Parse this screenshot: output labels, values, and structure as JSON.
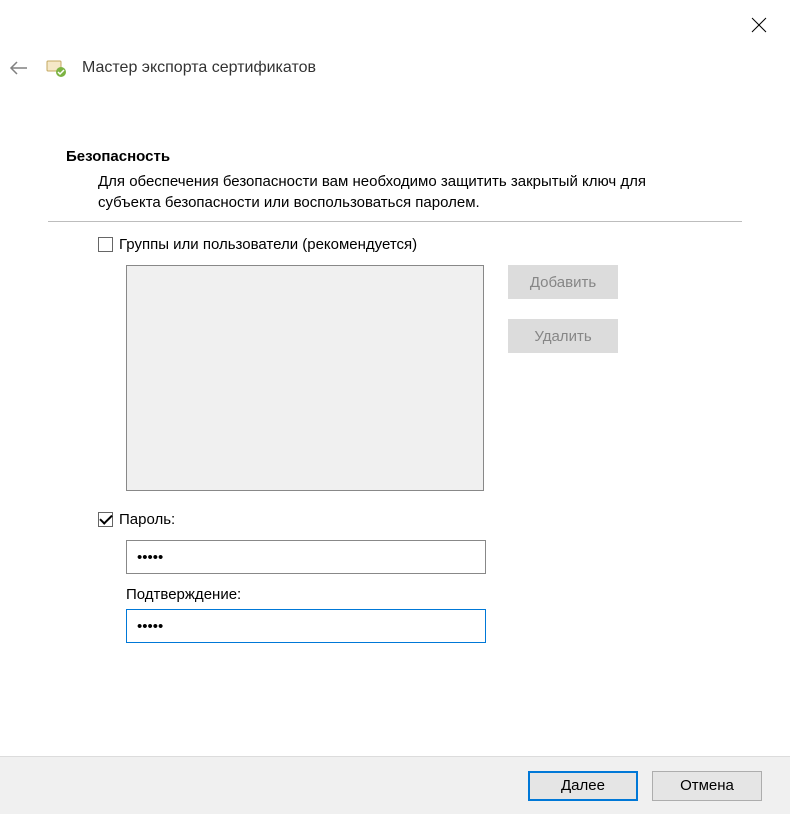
{
  "window": {
    "close_icon": "close-icon",
    "back_icon": "back-arrow-icon"
  },
  "wizard": {
    "title": "Мастер экспорта сертификатов"
  },
  "security": {
    "title": "Безопасность",
    "description": "Для обеспечения безопасности вам необходимо защитить закрытый ключ для субъекта безопасности или воспользоваться паролем.",
    "groups": {
      "checkbox_label": "Группы или пользователи (рекомендуется)",
      "checked": false,
      "add_button": "Добавить",
      "remove_button": "Удалить"
    },
    "password": {
      "checkbox_label": "Пароль:",
      "checked": true,
      "value": "•••••",
      "confirm_label": "Подтверждение:",
      "confirm_value": "•••••"
    }
  },
  "footer": {
    "next_button": "Далее",
    "cancel_button": "Отмена"
  }
}
